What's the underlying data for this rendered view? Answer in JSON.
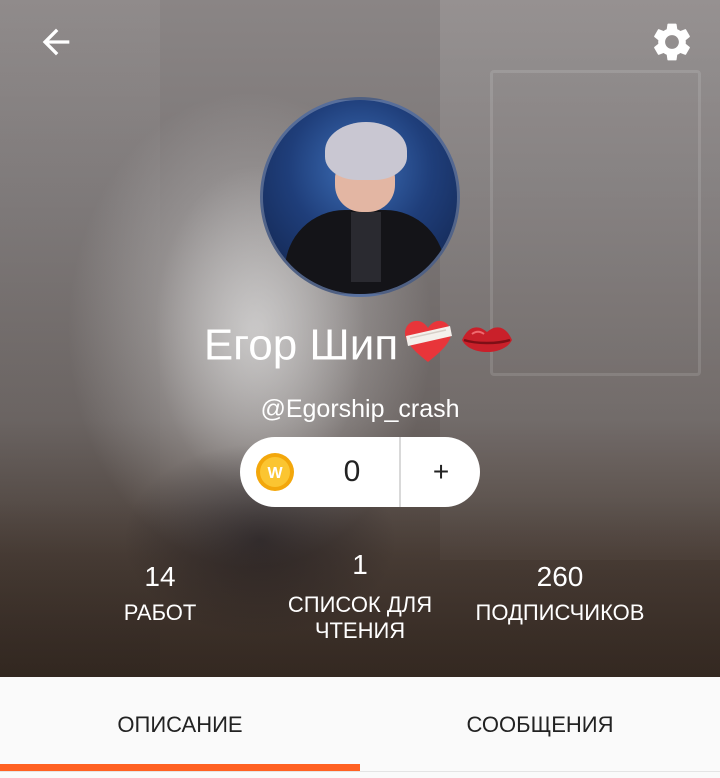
{
  "header": {
    "back_icon": "arrow-left-icon",
    "settings_icon": "gear-icon"
  },
  "profile": {
    "display_name": "Егор Шип",
    "name_emojis": [
      "bandaged-heart-emoji",
      "lips-kiss-emoji"
    ],
    "username": "@Egorship_crash"
  },
  "coins": {
    "icon": "wattpad-coin-icon",
    "coin_letter": "W",
    "value": "0",
    "add_label": "+"
  },
  "stats": {
    "works": {
      "value": "14",
      "label": "РАБОТ"
    },
    "reading_lists": {
      "value": "1",
      "label_line1": "СПИСОК ДЛЯ",
      "label_line2": "ЧТЕНИЯ"
    },
    "followers": {
      "value": "260",
      "label": "ПОДПИСЧИКОВ"
    }
  },
  "tabs": [
    {
      "label": "ОПИСАНИЕ",
      "active": true
    },
    {
      "label": "СООБЩЕНИЯ",
      "active": false
    }
  ],
  "colors": {
    "accent": "#ff6122",
    "coin": "#f3a70b"
  }
}
